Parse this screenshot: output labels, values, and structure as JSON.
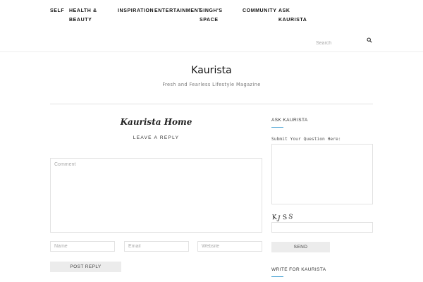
{
  "nav": {
    "items": [
      {
        "label": "SELF"
      },
      {
        "label": "HEALTH &"
      },
      {
        "label": "BEAUTY"
      },
      {
        "label": "INSPIRATION"
      },
      {
        "label": "ENTERTAINMENT"
      },
      {
        "label": "SINGH'S"
      },
      {
        "label": "SPACE"
      },
      {
        "label": "COMMUNITY"
      },
      {
        "label": "ASK"
      },
      {
        "label": "KAURISTA"
      }
    ],
    "search_placeholder": "Search",
    "search_icon": "search-icon"
  },
  "header": {
    "site_title": "Kaurista",
    "tagline": "Fresh and Fearless Lifestyle Magazine"
  },
  "main": {
    "page_title": "Kaurista Home",
    "leave_reply": "LEAVE A REPLY",
    "comment_placeholder": "Comment",
    "name_placeholder": "Name",
    "email_placeholder": "Email",
    "website_placeholder": "Website",
    "post_reply_label": "POST REPLY"
  },
  "sidebar": {
    "ask_title": "ASK KAURISTA",
    "question_label": "Submit Your Question Here:",
    "captcha_text": "KJSS",
    "send_label": "SEND",
    "write_title": "WRITE FOR KAURISTA",
    "accent_color": "#3a9bd0"
  }
}
